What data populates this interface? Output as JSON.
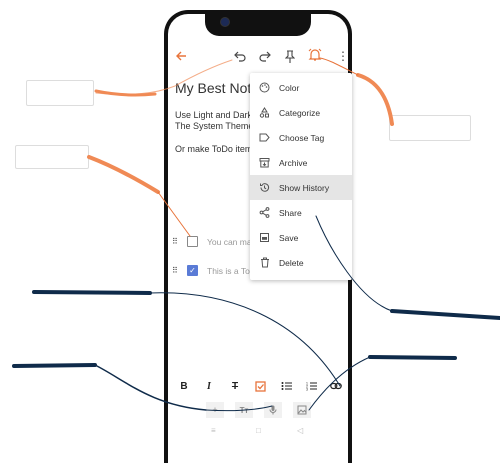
{
  "app": {
    "title": "My Best Note",
    "body_lines": [
      "Use Light and Dark",
      "The System Theme"
    ],
    "body_line3": "Or make ToDo item",
    "todos": [
      {
        "text": "You can ma",
        "checked": false
      },
      {
        "text": "This is a To",
        "checked": true
      }
    ],
    "accent_color": "#e8743b",
    "checkbox_color": "#5a7bd6"
  },
  "topbar_icons": [
    "back-arrow-icon",
    "undo-icon",
    "redo-icon",
    "pin-icon",
    "reminder-bell-icon",
    "more-vert-icon"
  ],
  "menu": {
    "items": [
      {
        "label": "Color",
        "icon": "palette-icon"
      },
      {
        "label": "Categorize",
        "icon": "category-icon"
      },
      {
        "label": "Choose Tag",
        "icon": "tag-icon"
      },
      {
        "label": "Archive",
        "icon": "archive-icon"
      },
      {
        "label": "Show History",
        "icon": "history-icon",
        "highlight": true
      },
      {
        "label": "Share",
        "icon": "share-icon"
      },
      {
        "label": "Save",
        "icon": "save-icon"
      },
      {
        "label": "Delete",
        "icon": "trash-icon"
      }
    ]
  },
  "format_toolbar": [
    "bold-icon",
    "italic-icon",
    "strikethrough-icon",
    "checkbox-icon",
    "bullet-list-icon",
    "numbered-list-icon",
    "link-icon"
  ],
  "bottom_toolbar": [
    "add-icon",
    "text-format-icon",
    "microphone-icon",
    "image-icon"
  ],
  "nav": [
    "recent-apps-icon",
    "home-icon",
    "back-icon"
  ],
  "colors": {
    "callout_orange": "#f08a55",
    "callout_navy": "#0f2b4a"
  }
}
